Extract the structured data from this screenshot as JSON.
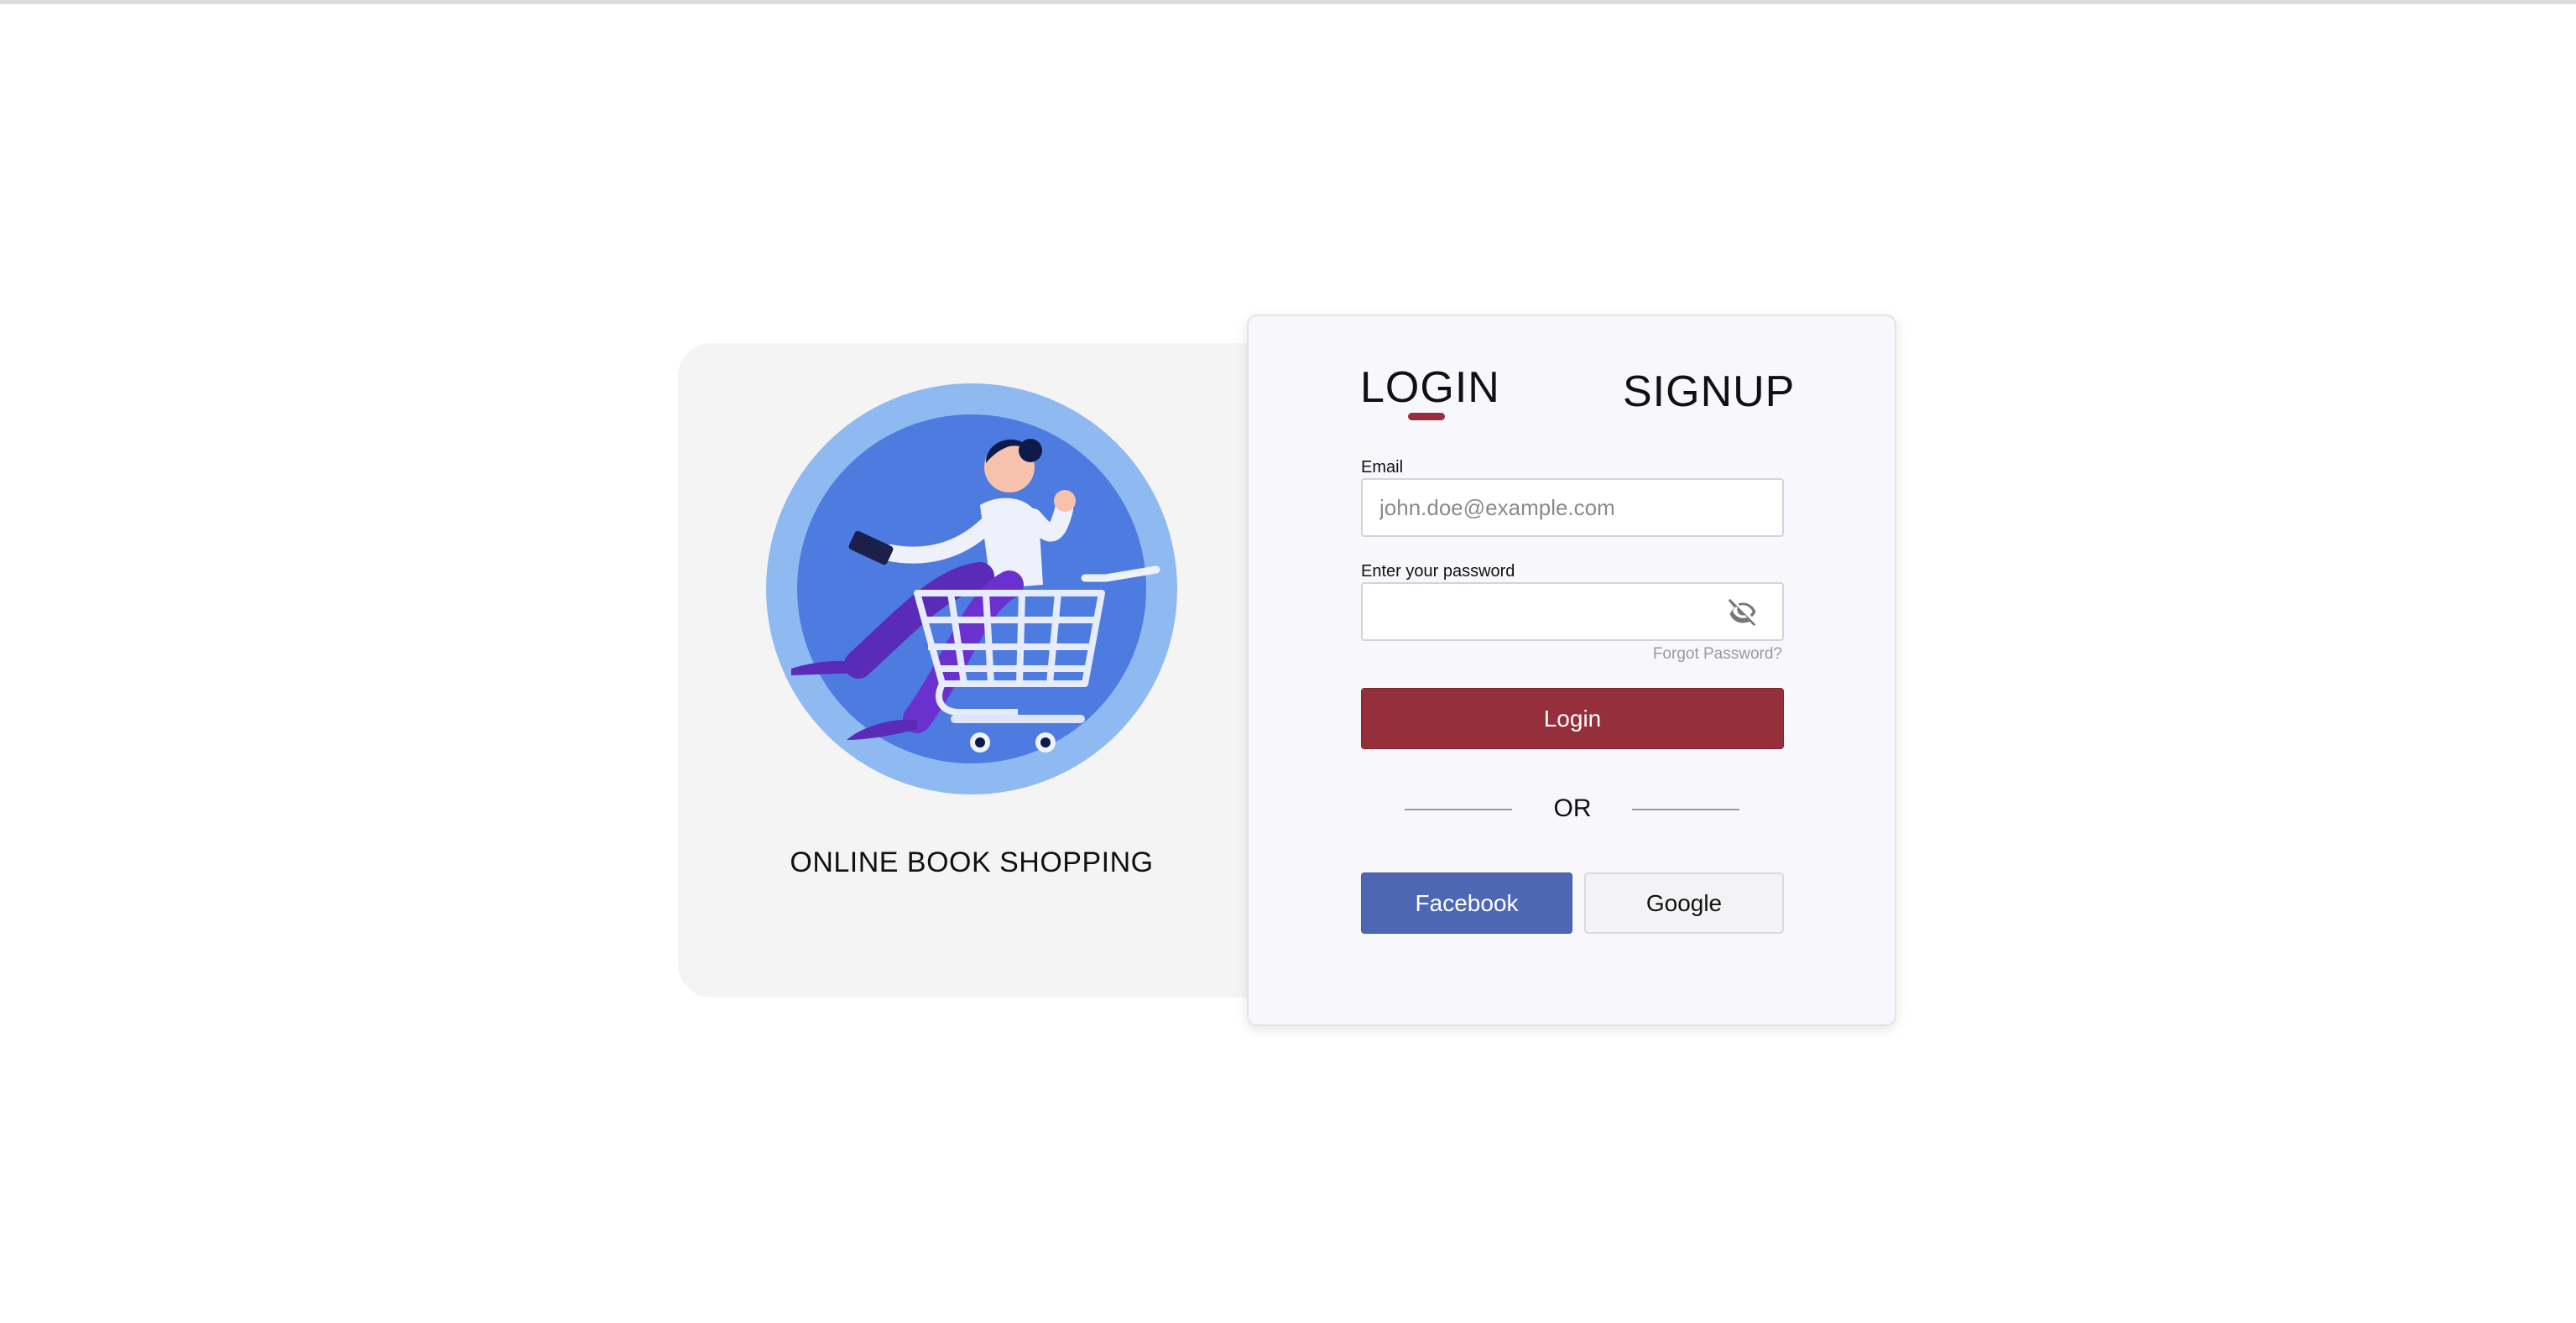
{
  "brand": {
    "title": "ONLINE BOOK SHOPPING",
    "illustration": "woman-in-shopping-cart-illustration"
  },
  "tabs": {
    "login": "LOGIN",
    "signup": "SIGNUP",
    "active": "login"
  },
  "form": {
    "email_label": "Email",
    "email_placeholder": "john.doe@example.com",
    "email_value": "",
    "password_label": "Enter your password",
    "password_placeholder": "",
    "password_value": "",
    "password_toggle_icon": "eye-off-icon",
    "forgot_password": "Forgot Password?",
    "login_button": "Login"
  },
  "divider": {
    "text": "OR"
  },
  "social": {
    "facebook": "Facebook",
    "google": "Google"
  },
  "colors": {
    "accent": "#962f3c",
    "facebook": "#4d67b4",
    "illustration_outer": "#8fb9f1",
    "illustration_inner": "#4e7be0"
  }
}
